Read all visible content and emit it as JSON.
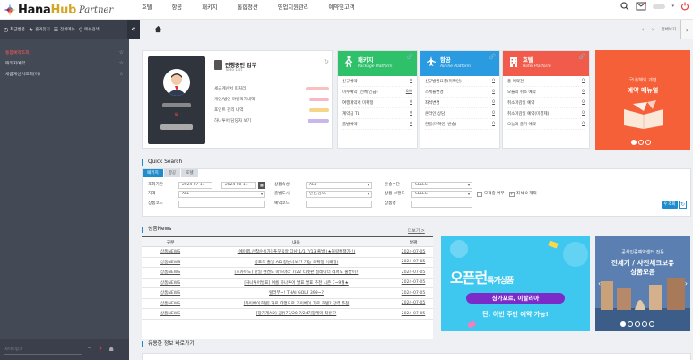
{
  "brand": {
    "name_a": "Hana",
    "name_b": "Hub",
    "suffix": "Partner"
  },
  "gnb": [
    "호텔",
    "항공",
    "패키지",
    "통합정산",
    "영업지원관리",
    "예약및고객"
  ],
  "subtabs": [
    {
      "label": "최근방문"
    },
    {
      "label": "즐겨찾기"
    },
    {
      "label": "전체메뉴"
    },
    {
      "label": "메뉴검색"
    }
  ],
  "subnav": {
    "all_view": "전체보기"
  },
  "sidebar": {
    "items": [
      {
        "label": "통합예약조회"
      },
      {
        "label": "패키지예약"
      },
      {
        "label": "세금계산서조회(이)"
      }
    ],
    "search_placeholder": "사이트링크"
  },
  "todo": {
    "title": "진행중인 업무",
    "subtitle": "Todo List",
    "items": [
      "세금계산서 미처리",
      "개인/법인 마일리지내역",
      "포인트 관리 내역",
      "하나투어 담당자 보기"
    ]
  },
  "package": {
    "title": "패키지",
    "subtitle": "Package Platform",
    "rows": [
      {
        "label": "신규예약",
        "value": "0"
      },
      {
        "label": "미수예약 (전체/긴급)",
        "value": "0/0"
      },
      {
        "label": "여행계약서 미확정",
        "value": "0"
      },
      {
        "label": "계약금 TL",
        "value": "0"
      },
      {
        "label": "출발예약",
        "value": "0"
      }
    ]
  },
  "air": {
    "title": "항공",
    "subtitle": "Airline Platform",
    "rows": [
      {
        "label": "신규발권요청(미확인)",
        "value": "0"
      },
      {
        "label": "스케쥴변경",
        "value": "0"
      },
      {
        "label": "좌석변경",
        "value": "0"
      },
      {
        "label": "온라인 상담",
        "value": "0"
      },
      {
        "label": "환불(미확인, 반송)",
        "value": "0"
      }
    ]
  },
  "hotel": {
    "title": "호텔",
    "subtitle": "Hotel Platform",
    "rows": [
      {
        "label": "총 예약건",
        "value": "0"
      },
      {
        "label": "오늘의 취소 예약",
        "value": "0"
      },
      {
        "label": "취소마감일 예약",
        "value": "0"
      },
      {
        "label": "취소마감일 예약(미결제)",
        "value": "0"
      },
      {
        "label": "오늘의 출가 예약",
        "value": "0"
      }
    ]
  },
  "promo1": {
    "line1": "국내/해외 개편",
    "line2": "예약 매뉴얼"
  },
  "quick": {
    "title": "Quick Search",
    "tabs": [
      "패키지",
      "항공",
      "호텔"
    ],
    "period_label": "조회기간",
    "date_from": "2024-07-11",
    "date_to": "2024-08-11",
    "product_prop_label": "상품속성",
    "product_prop_value": "ALL",
    "transport_label": "운송수단",
    "transport_value": "SELECT",
    "region_label": "지역",
    "region_value": "ALL",
    "depart_city_label": "출발도시",
    "depart_city_value": "인천,김포,",
    "brand_label": "상품 브랜드",
    "brand_value": "SELECT",
    "check1": "모객중 여부",
    "check2": "좌석 0 제외",
    "code_label": "상품코드",
    "reserve_code_label": "예약코드",
    "product_name_label": "상품명",
    "search_btn": "조회"
  },
  "news": {
    "title": "상품News",
    "more": "더보기 >",
    "headers": [
      "구분",
      "내용",
      "날짜"
    ],
    "rows": [
      {
        "cat": "상품NEWS",
        "title": "[에이랩,선착순특가] 푸꾸옥알 다낭 1/1 7/13 출발 (★블랑특쟁가!!)",
        "date": "2024-07-05"
      },
      {
        "cat": "상품NEWS",
        "title": "공포도 출발 AD 항남나보?? 가능 꼭확정!!(패밀)",
        "date": "2024-07-05"
      },
      {
        "cat": "상품NEWS",
        "title": "[호카이도] 한일 렌켄도 마쓰마라 7/22 티켓판 필레이터 레퍼도 출발이?",
        "date": "2024-07-05"
      },
      {
        "cat": "상품NEWS",
        "title": "[하나투어발표] 여름 하나투어 발표 발표 추천 시즌 7~9월★",
        "date": "2024-07-05"
      },
      {
        "cat": "상품NEWS",
        "title": "럴러부~! THAI GOLF 399~?",
        "date": "2024-07-05"
      },
      {
        "cat": "상품NEWS",
        "title": "[타이베이호텔] 가로 여행으로 가이베이 가로 호텔? 강력 추천",
        "date": "2024-07-05"
      },
      {
        "cat": "상품NEWS",
        "title": "[장가계AD] 공유77/20 7/24기장계미 최유??",
        "date": "2024-07-05"
      }
    ]
  },
  "banner1": {
    "big": "오픈런",
    "small": "특가상품",
    "pill": "싱가포르, 이탈리아",
    "sub": "단, 이번 주만 예약 가능!"
  },
  "banner2": {
    "line1": "공식인증예약센터 전용",
    "line2": "전세기 / 사전체크보유",
    "line3": "상품모음"
  },
  "info": {
    "title": "유용한 정보 바로가기"
  },
  "colors": {
    "accent": "#1f8ccc",
    "sidebar": "#434955",
    "promo": "#f56038",
    "package": "#2fc06a",
    "air": "#2a9be0",
    "hotel": "#f05b4b"
  }
}
